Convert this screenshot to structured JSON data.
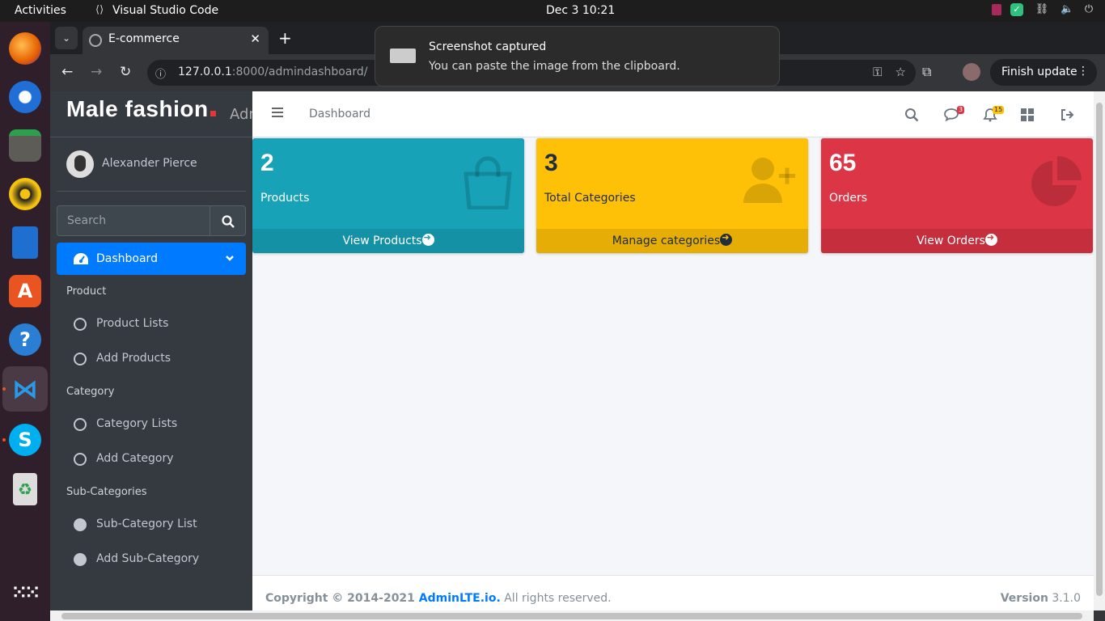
{
  "topbar": {
    "activities": "Activities",
    "app_name": "Visual Studio Code",
    "clock": "Dec 3  10:21"
  },
  "dock": {
    "items": [
      "firefox-icon",
      "thunderbird-icon",
      "files-icon",
      "rhythmbox-icon",
      "writer-icon",
      "app-center-icon",
      "help-icon",
      "vscode-icon",
      "skype-icon",
      "trash-icon",
      "app-grid-icon"
    ]
  },
  "browser": {
    "tab_title": "E-commerce",
    "url_host": "127.0.0.1",
    "url_rest": ":8000/admindashboard/",
    "update_label": "Finish update"
  },
  "notification": {
    "title": "Screenshot captured",
    "body": "You can paste the image from the clipboard."
  },
  "sidebar": {
    "brand": "Male fashion",
    "brand_sub": "Adm",
    "user_name": "Alexander Pierce",
    "search_placeholder": "Search",
    "active_item": "Dashboard",
    "sections": [
      {
        "header": "Product",
        "items": [
          "Product Lists",
          "Add Products"
        ]
      },
      {
        "header": "Category",
        "items": [
          "Category Lists",
          "Add Category"
        ]
      },
      {
        "header": "Sub-Categories",
        "items": [
          "Sub-Category List",
          "Add Sub-Category"
        ]
      }
    ]
  },
  "navbar": {
    "dashboard_link": "Dashboard",
    "messages_badge": "3",
    "notifications_badge": "15"
  },
  "boxes": [
    {
      "number": "2",
      "label": "Products",
      "footer": "View Products",
      "color": "#17a2b8"
    },
    {
      "number": "3",
      "label": "Total Categories",
      "footer": "Manage categories",
      "color": "#ffc107"
    },
    {
      "number": "65",
      "label": "Orders",
      "footer": "View Orders",
      "color": "#dc3545"
    }
  ],
  "footer": {
    "copyright": "Copyright © 2014-2021 ",
    "link": "AdminLTE.io.",
    "rights": " All rights reserved.",
    "version_label": "Version",
    "version": " 3.1.0"
  }
}
